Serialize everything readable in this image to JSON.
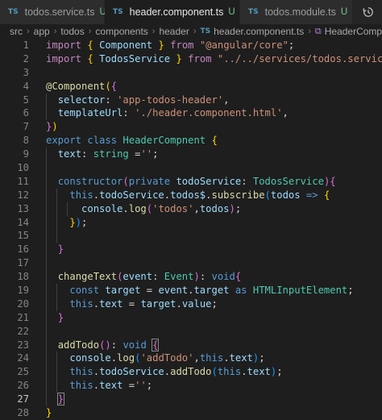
{
  "tabs": [
    {
      "icon": "TS",
      "label": "todos.service.ts",
      "status": "U"
    },
    {
      "icon": "TS",
      "label": "header.component.ts",
      "status": "U",
      "close": "✕"
    },
    {
      "icon": "TS",
      "label": "todos.module.ts",
      "status": "U"
    }
  ],
  "tab_actions_icon": "history-icon",
  "breadcrumb": {
    "parts": [
      "src",
      "app",
      "todos",
      "components",
      "header"
    ],
    "file_icon": "TS",
    "file": "header.component.ts",
    "symbol": "HeaderCompnent"
  },
  "lines": [
    {
      "n": "1"
    },
    {
      "n": "2"
    },
    {
      "n": "3"
    },
    {
      "n": "4"
    },
    {
      "n": "5"
    },
    {
      "n": "6"
    },
    {
      "n": "7"
    },
    {
      "n": "8"
    },
    {
      "n": "9"
    },
    {
      "n": "10"
    },
    {
      "n": "11"
    },
    {
      "n": "12"
    },
    {
      "n": "13"
    },
    {
      "n": "14"
    },
    {
      "n": "15"
    },
    {
      "n": "16"
    },
    {
      "n": "17"
    },
    {
      "n": "18"
    },
    {
      "n": "19"
    },
    {
      "n": "20"
    },
    {
      "n": "21"
    },
    {
      "n": "22"
    },
    {
      "n": "23"
    },
    {
      "n": "24"
    },
    {
      "n": "25"
    },
    {
      "n": "26"
    },
    {
      "n": "27"
    },
    {
      "n": "28"
    }
  ],
  "code": {
    "import": "import",
    "from": "from",
    "component": "Component",
    "angular_core": "\"@angular/core\"",
    "todos_service": "TodosService",
    "service_path": "\"../../services/todos.service\"",
    "decorator": "@Component",
    "selector": "selector",
    "selector_val": "'app-todos-header'",
    "template_url": "templateUrl",
    "template_val": "'./header.component.html'",
    "export": "export",
    "class": "class",
    "class_name": "HeaderCompnent",
    "text": "text",
    "string": "string",
    "empty_str": "''",
    "constructor": "constructor",
    "private": "private",
    "todo_service": "todoService",
    "this": "this",
    "todos$": "todos$",
    "subscribe": "subscribe",
    "todos": "todos",
    "arrow": "=>",
    "console": "console",
    "log": "log",
    "todos_str": "'todos'",
    "change_text": "changeText",
    "event": "event",
    "event_type": "Event",
    "void": "void",
    "const": "const",
    "target": "target",
    "as": "as",
    "html_input": "HTMLInputElement",
    "value": "value",
    "add_todo": "addTodo",
    "add_todo_str": "'addTodo'"
  }
}
